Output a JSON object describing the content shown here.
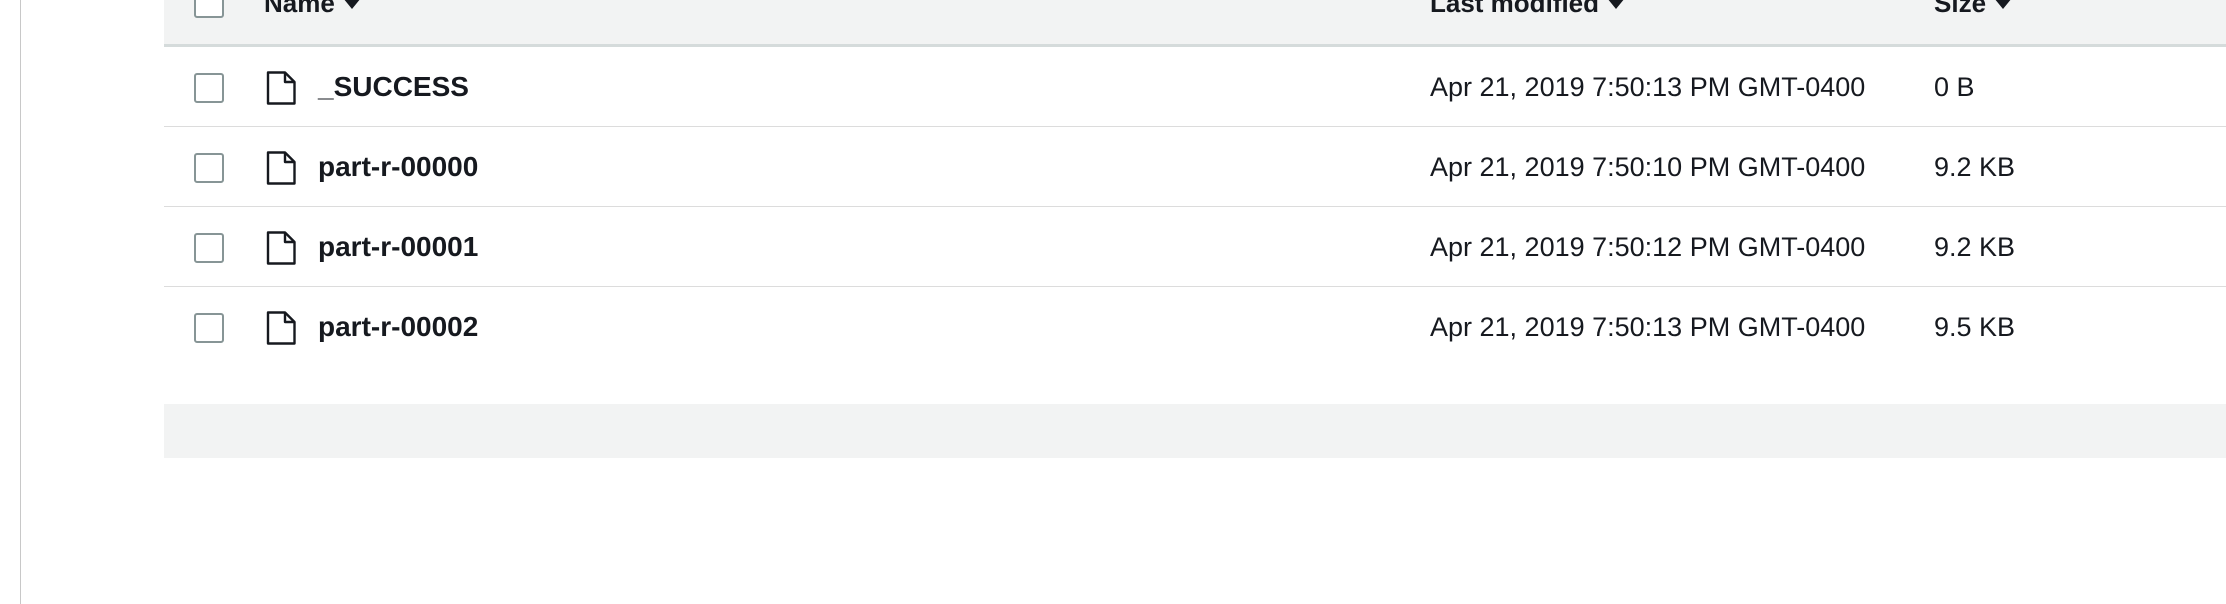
{
  "table": {
    "columns": {
      "name": "Name",
      "last_modified": "Last modified",
      "size": "Size"
    },
    "rows": [
      {
        "icon": "file-icon",
        "name": "_SUCCESS",
        "last_modified": "Apr 21, 2019 7:50:13 PM GMT-0400",
        "size": "0 B"
      },
      {
        "icon": "file-icon",
        "name": "part-r-00000",
        "last_modified": "Apr 21, 2019 7:50:10 PM GMT-0400",
        "size": "9.2 KB"
      },
      {
        "icon": "file-icon",
        "name": "part-r-00001",
        "last_modified": "Apr 21, 2019 7:50:12 PM GMT-0400",
        "size": "9.2 KB"
      },
      {
        "icon": "file-icon",
        "name": "part-r-00002",
        "last_modified": "Apr 21, 2019 7:50:13 PM GMT-0400",
        "size": "9.5 KB"
      }
    ]
  },
  "colors": {
    "header_background": "#f2f3f3",
    "text": "#16191f",
    "checkbox_border": "#879596",
    "row_divider": "#dcdcdc"
  }
}
